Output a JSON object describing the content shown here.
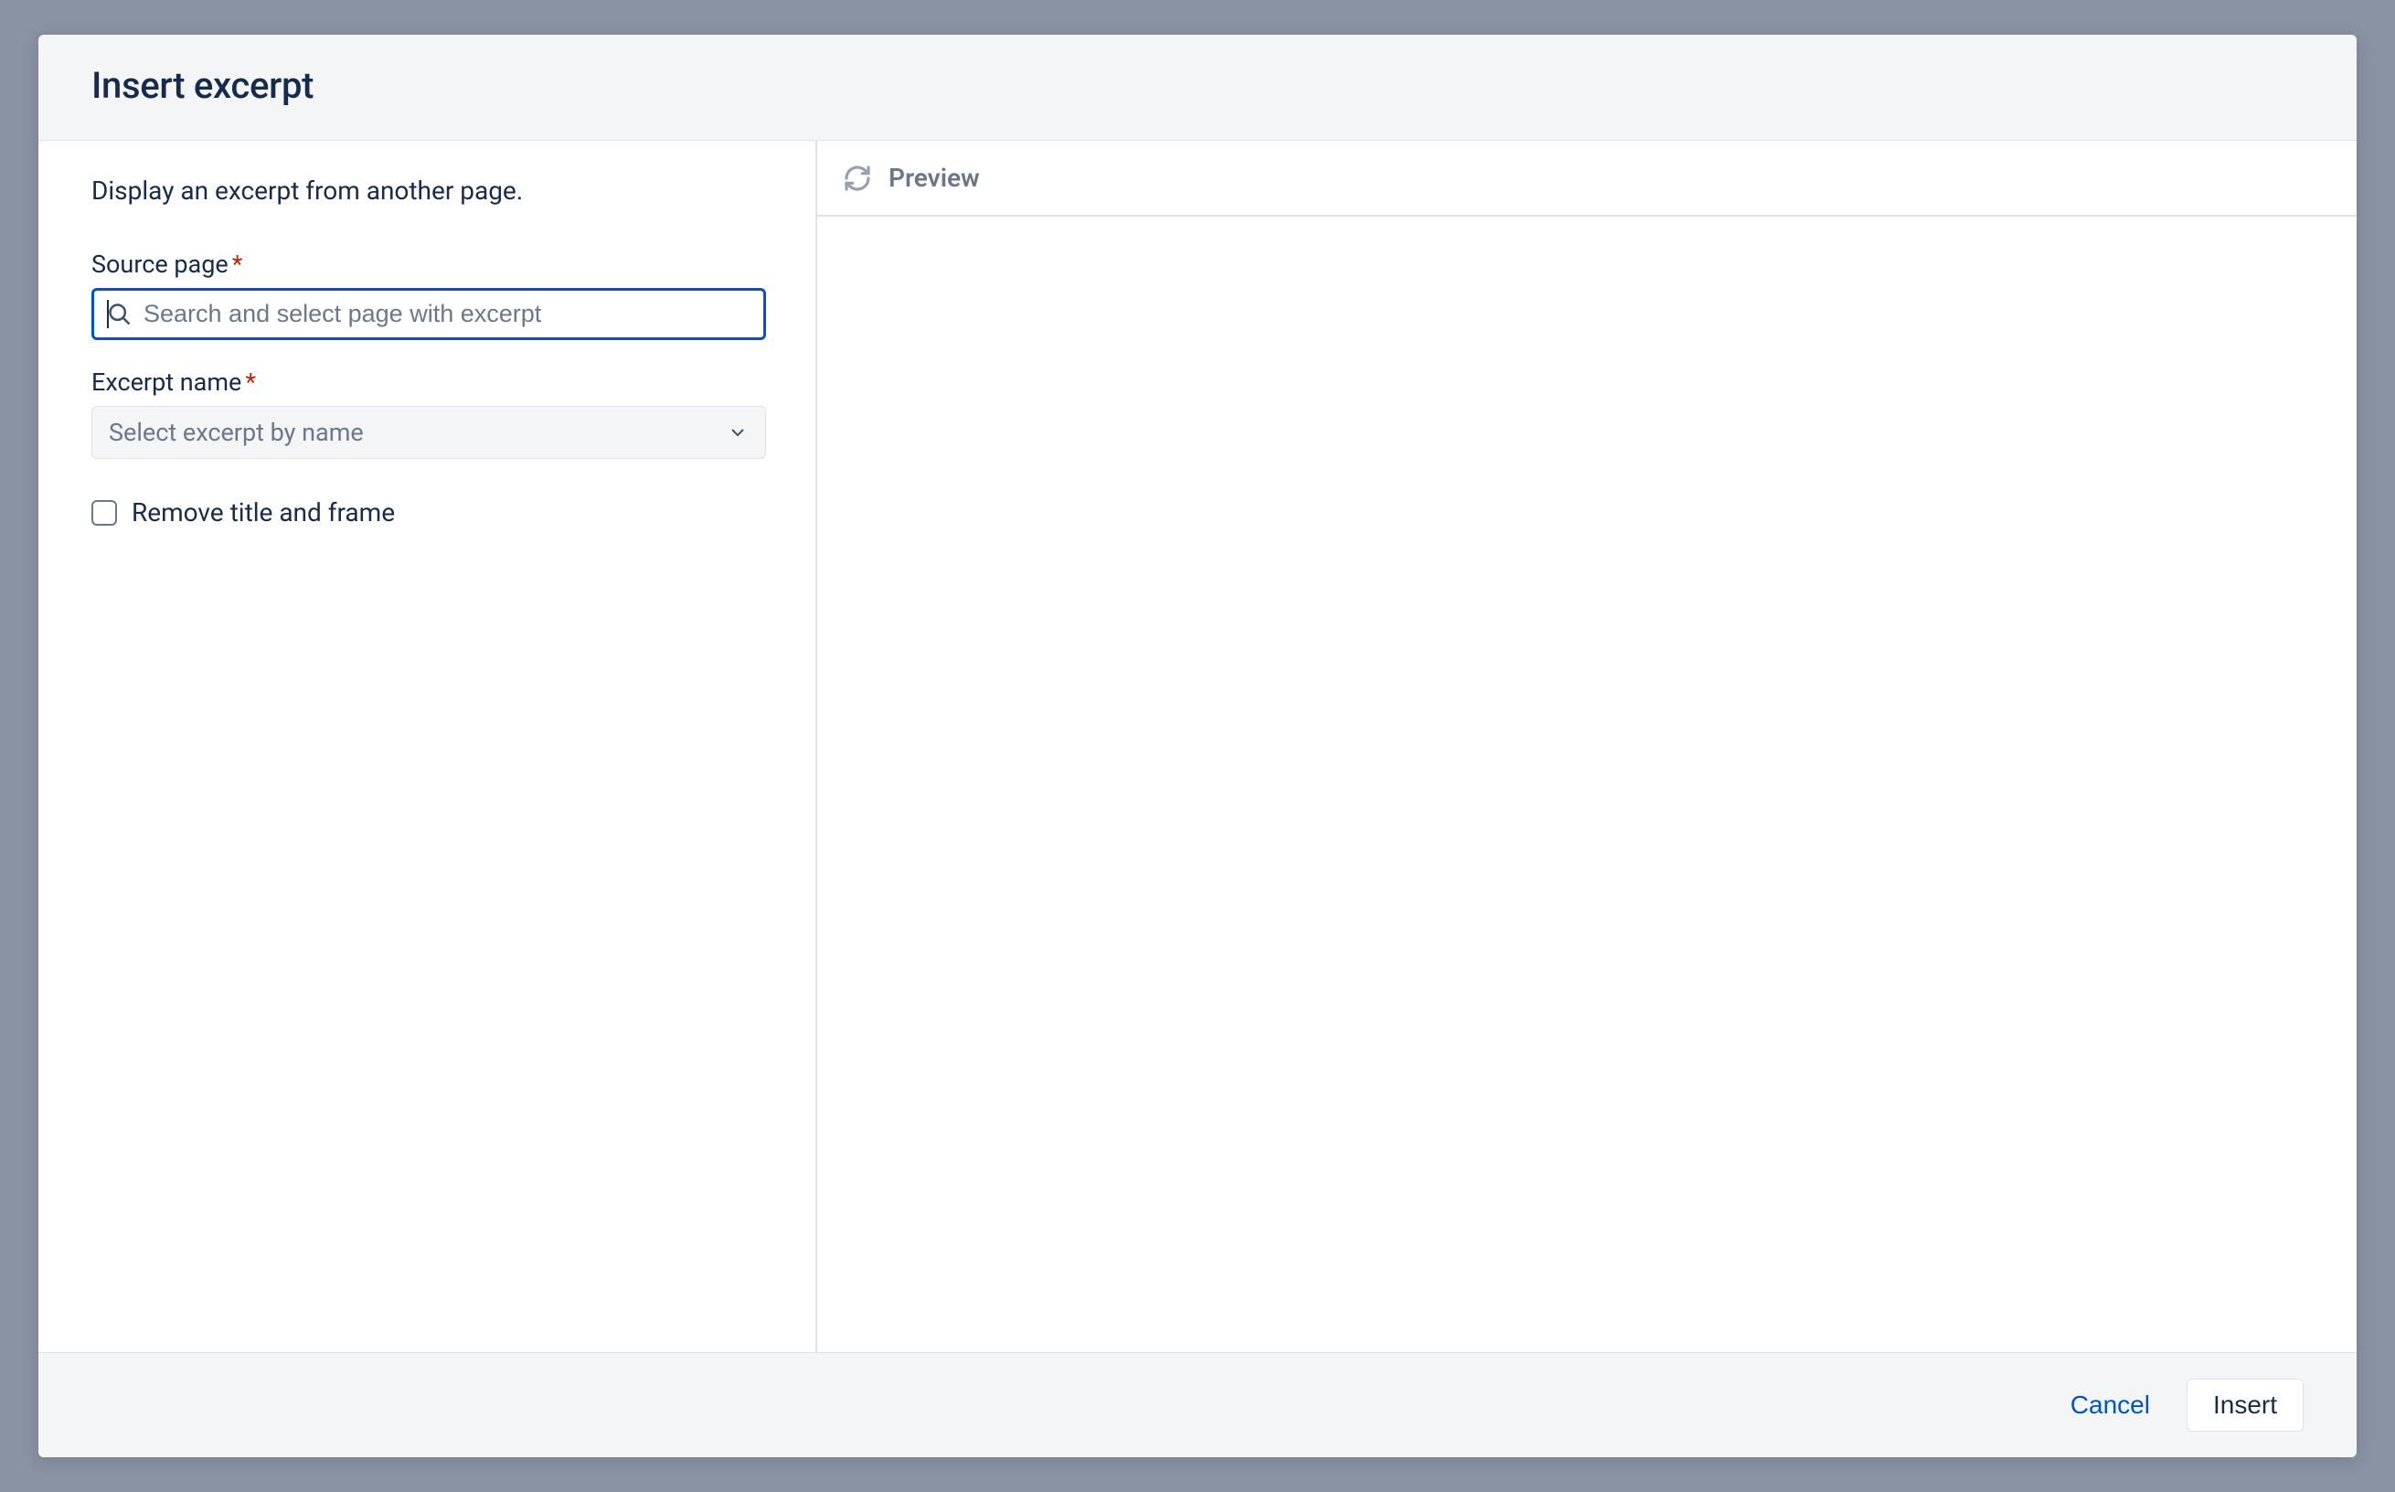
{
  "dialog": {
    "title": "Insert excerpt",
    "description": "Display an excerpt from another page."
  },
  "form": {
    "sourcePage": {
      "label": "Source page",
      "placeholder": "Search and select page with excerpt",
      "required": true
    },
    "excerptName": {
      "label": "Excerpt name",
      "placeholder": "Select excerpt by name",
      "required": true
    },
    "removeTitle": {
      "label": "Remove title and frame",
      "checked": false
    }
  },
  "preview": {
    "title": "Preview"
  },
  "footer": {
    "cancel": "Cancel",
    "insert": "Insert"
  }
}
